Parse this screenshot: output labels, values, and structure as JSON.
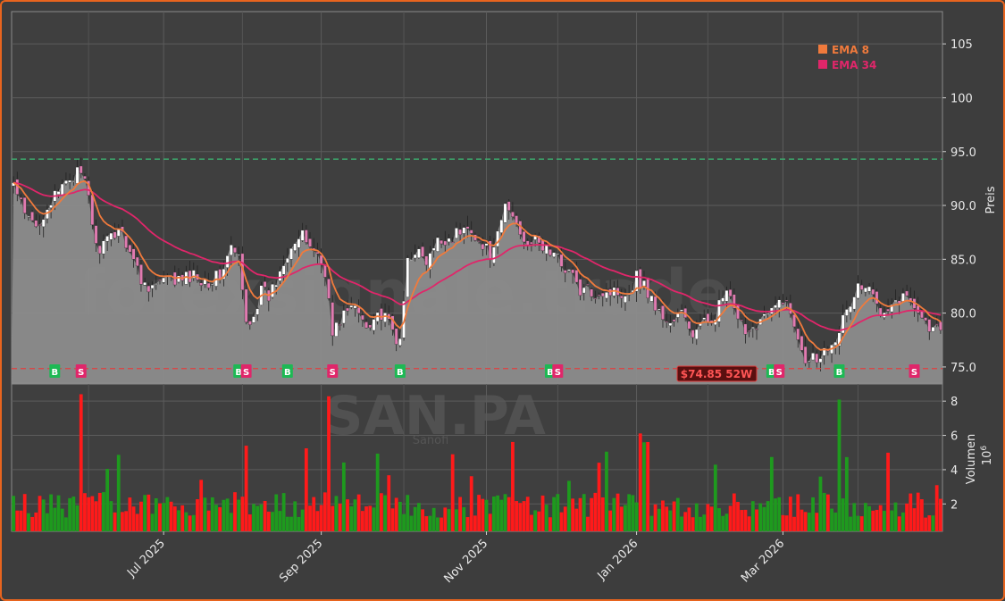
{
  "chart_data": {
    "type": "candlestick",
    "symbol": "SAN.PA",
    "company": "Sanofi",
    "watermark": "forexsignale.trade",
    "price_panel": {
      "ylabel": "Preis",
      "ylim": [
        73.5,
        108
      ],
      "yticks": [
        "75.0",
        "80.0",
        "85.0",
        "90.0",
        "95.0",
        "100",
        "105"
      ],
      "ytick_values": [
        75,
        80,
        85,
        90,
        95,
        100,
        105
      ],
      "grid": true,
      "resistance_line": 94.3,
      "support_line": 74.85,
      "support_label": "$74.85 52W",
      "legend": [
        {
          "label": "EMA 8",
          "color": "#f07a3c"
        },
        {
          "label": "EMA 34",
          "color": "#e0266a"
        }
      ]
    },
    "volume_panel": {
      "ylabel": "Volumen",
      "unit": "10",
      "unit_exp": "6",
      "ylim": [
        0.4,
        9.0
      ],
      "yticks": [
        "2",
        "4",
        "6",
        "8"
      ],
      "ytick_values": [
        2,
        4,
        6,
        8
      ]
    },
    "x_axis": {
      "ticks": [
        "Jul 2025",
        "Sep 2025",
        "Nov 2025",
        "Jan 2026",
        "Mar 2026"
      ],
      "tick_index": [
        40,
        82,
        126,
        166,
        205
      ]
    },
    "n_bars": 248,
    "close_anchors": [
      [
        0,
        92
      ],
      [
        3,
        89
      ],
      [
        6,
        88
      ],
      [
        9,
        90
      ],
      [
        12,
        91
      ],
      [
        14,
        92.5
      ],
      [
        17,
        93
      ],
      [
        19,
        92
      ],
      [
        20,
        91
      ],
      [
        22,
        86
      ],
      [
        25,
        86.5
      ],
      [
        28,
        88
      ],
      [
        31,
        86
      ],
      [
        34,
        83
      ],
      [
        37,
        82.5
      ],
      [
        40,
        83
      ],
      [
        44,
        83
      ],
      [
        48,
        83.5
      ],
      [
        52,
        83
      ],
      [
        55,
        83.5
      ],
      [
        58,
        86
      ],
      [
        60,
        85
      ],
      [
        62,
        79
      ],
      [
        64,
        80
      ],
      [
        66,
        82
      ],
      [
        68,
        81.5
      ],
      [
        70,
        83
      ],
      [
        72,
        85
      ],
      [
        74,
        86.5
      ],
      [
        77,
        87
      ],
      [
        80,
        86
      ],
      [
        83,
        84
      ],
      [
        85,
        78
      ],
      [
        88,
        80
      ],
      [
        91,
        80.5
      ],
      [
        94,
        79
      ],
      [
        97,
        80
      ],
      [
        100,
        79
      ],
      [
        103,
        77
      ],
      [
        105,
        85
      ],
      [
        107,
        86
      ],
      [
        110,
        84.5
      ],
      [
        113,
        86.5
      ],
      [
        116,
        87
      ],
      [
        119,
        87.5
      ],
      [
        122,
        88
      ],
      [
        125,
        86
      ],
      [
        128,
        85.5
      ],
      [
        131,
        90
      ],
      [
        133,
        89
      ],
      [
        136,
        87
      ],
      [
        139,
        86.5
      ],
      [
        142,
        86
      ],
      [
        145,
        85
      ],
      [
        148,
        84
      ],
      [
        151,
        82
      ],
      [
        155,
        82
      ],
      [
        158,
        82
      ],
      [
        161,
        82
      ],
      [
        164,
        82
      ],
      [
        166,
        83.5
      ],
      [
        169,
        82
      ],
      [
        172,
        80
      ],
      [
        175,
        79
      ],
      [
        178,
        80
      ],
      [
        181,
        78
      ],
      [
        184,
        79
      ],
      [
        187,
        80
      ],
      [
        190,
        82
      ],
      [
        193,
        79
      ],
      [
        196,
        78.5
      ],
      [
        199,
        79.5
      ],
      [
        202,
        80
      ],
      [
        205,
        81.5
      ],
      [
        208,
        79
      ],
      [
        211,
        76
      ],
      [
        214,
        76
      ],
      [
        216,
        76.5
      ],
      [
        219,
        78
      ],
      [
        222,
        80
      ],
      [
        225,
        82.5
      ],
      [
        228,
        82
      ],
      [
        231,
        80.5
      ],
      [
        234,
        81
      ],
      [
        237,
        81.5
      ],
      [
        240,
        81
      ],
      [
        243,
        79
      ],
      [
        245,
        78.5
      ],
      [
        247,
        78.5
      ]
    ],
    "buy_signals": [
      11,
      60,
      73,
      103,
      143,
      202,
      220
    ],
    "sell_signals": [
      18,
      62,
      85,
      145,
      204,
      240
    ],
    "volume_seed": 42
  }
}
